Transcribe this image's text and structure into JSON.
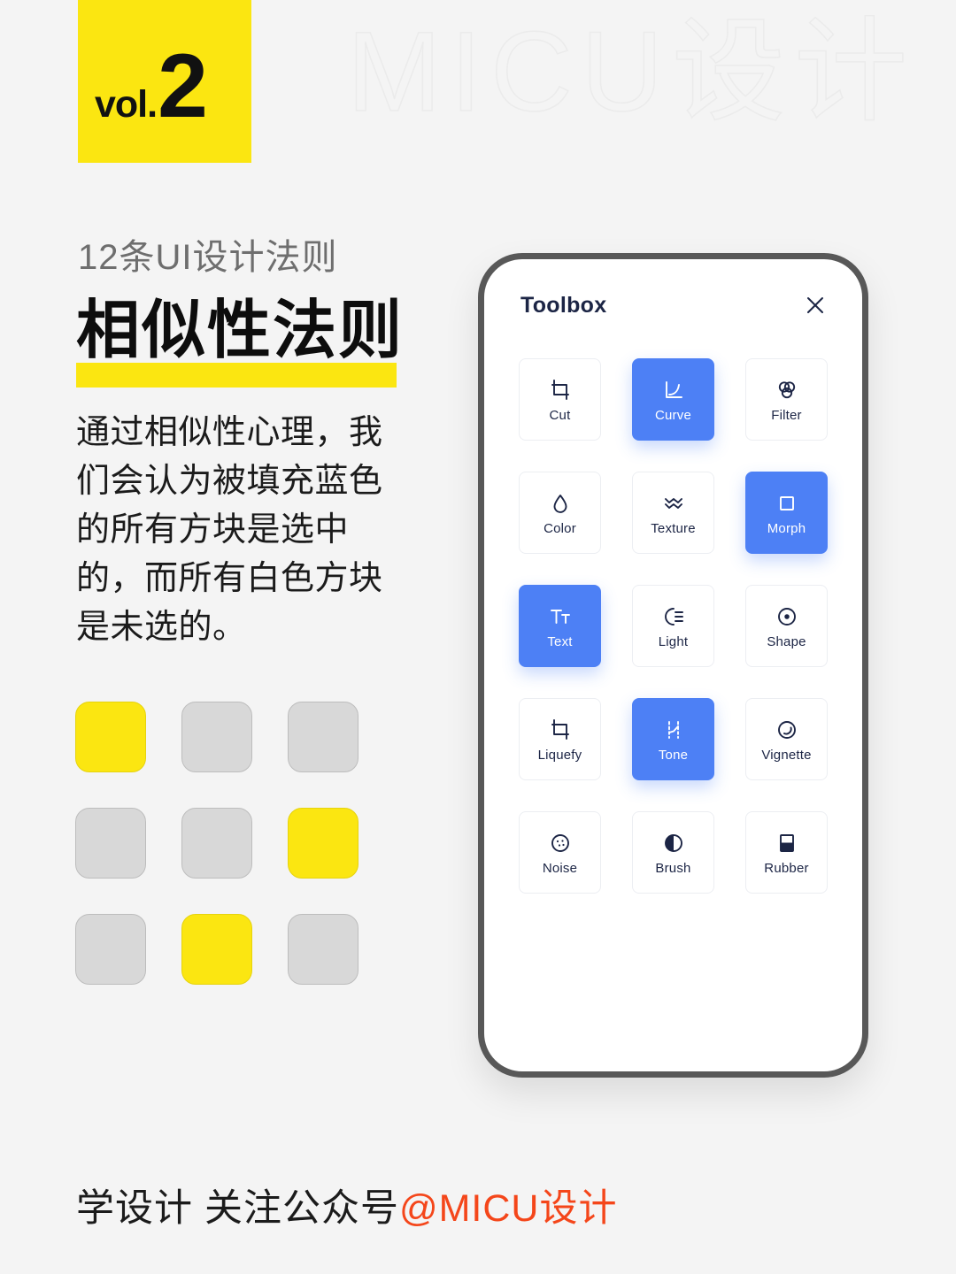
{
  "watermark": {
    "text": "MICU设计"
  },
  "badge": {
    "word": "vol.",
    "number": "2"
  },
  "left": {
    "subtitle": "12条UI设计法则",
    "headline": "相似性法则",
    "body": "通过相似性心理，我们会认为被填充蓝色的所有方块是选中的，而所有白色方块是未选的。"
  },
  "colors": {
    "accent_yellow": "#fbe611",
    "accent_blue": "#4d80f5",
    "square_gray": "#d8d8d8",
    "brand_orange": "#f4461a",
    "navy": "#1c2545",
    "page_bg": "#f4f4f4"
  },
  "squares": {
    "legend_selected": "selected",
    "legend_unselected": "unselected",
    "cells": [
      {
        "state": "selected"
      },
      {
        "state": "unselected"
      },
      {
        "state": "unselected"
      },
      {
        "state": "unselected"
      },
      {
        "state": "unselected"
      },
      {
        "state": "selected"
      },
      {
        "state": "unselected"
      },
      {
        "state": "selected"
      },
      {
        "state": "unselected"
      }
    ]
  },
  "phone": {
    "header": {
      "title": "Toolbox",
      "close_icon": "close-icon"
    },
    "tools": [
      {
        "label": "Cut",
        "icon": "crop-icon",
        "selected": false
      },
      {
        "label": "Curve",
        "icon": "curve-icon",
        "selected": true
      },
      {
        "label": "Filter",
        "icon": "filter-icon",
        "selected": false
      },
      {
        "label": "Color",
        "icon": "droplet-icon",
        "selected": false
      },
      {
        "label": "Texture",
        "icon": "texture-icon",
        "selected": false
      },
      {
        "label": "Morph",
        "icon": "square-icon",
        "selected": true
      },
      {
        "label": "Text",
        "icon": "text-icon",
        "selected": true
      },
      {
        "label": "Light",
        "icon": "light-icon",
        "selected": false
      },
      {
        "label": "Shape",
        "icon": "shape-icon",
        "selected": false
      },
      {
        "label": "Liquefy",
        "icon": "crop-icon",
        "selected": false
      },
      {
        "label": "Tone",
        "icon": "tone-icon",
        "selected": true
      },
      {
        "label": "Vignette",
        "icon": "vignette-icon",
        "selected": false
      },
      {
        "label": "Noise",
        "icon": "noise-icon",
        "selected": false
      },
      {
        "label": "Brush",
        "icon": "brush-icon",
        "selected": false
      },
      {
        "label": "Rubber",
        "icon": "rubber-icon",
        "selected": false
      }
    ]
  },
  "footer": {
    "text": "学设计 关注公众号",
    "handle": "@MICU设计"
  }
}
